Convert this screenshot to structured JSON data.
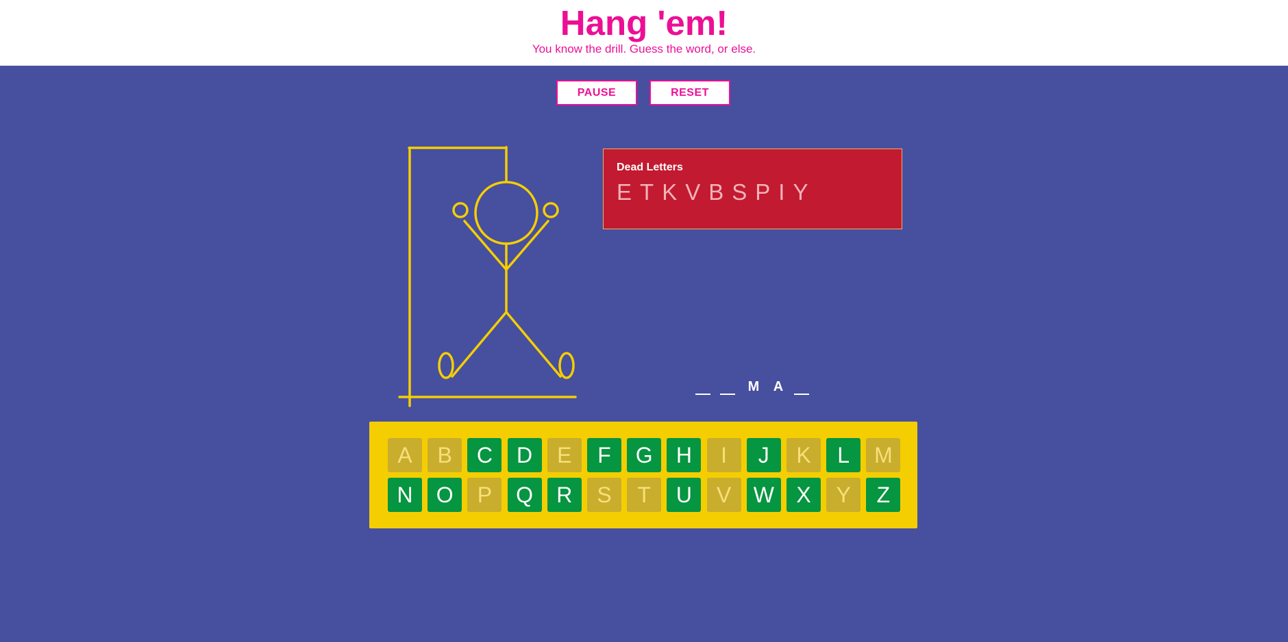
{
  "header": {
    "title": "Hang 'em!",
    "subtitle": "You know the drill. Guess the word, or else."
  },
  "controls": {
    "pause_label": "PAUSE",
    "reset_label": "RESET"
  },
  "dead_letters": {
    "title": "Dead Letters",
    "letters": [
      "E",
      "T",
      "K",
      "V",
      "B",
      "S",
      "P",
      "I",
      "Y"
    ]
  },
  "word": {
    "slots": [
      "",
      "",
      "M",
      "A",
      ""
    ]
  },
  "colors": {
    "accent": "#ec0f96",
    "background": "#474f9f",
    "gallows": "#f5ce02",
    "available_key": "#069540",
    "used_key": "#c9ad2d",
    "dead_box": "#c21a30"
  },
  "keyboard": {
    "rows": [
      [
        {
          "letter": "A",
          "state": "used"
        },
        {
          "letter": "B",
          "state": "used"
        },
        {
          "letter": "C",
          "state": "available"
        },
        {
          "letter": "D",
          "state": "available"
        },
        {
          "letter": "E",
          "state": "used"
        },
        {
          "letter": "F",
          "state": "available"
        },
        {
          "letter": "G",
          "state": "available"
        },
        {
          "letter": "H",
          "state": "available"
        },
        {
          "letter": "I",
          "state": "used"
        },
        {
          "letter": "J",
          "state": "available"
        },
        {
          "letter": "K",
          "state": "used"
        },
        {
          "letter": "L",
          "state": "available"
        },
        {
          "letter": "M",
          "state": "used"
        }
      ],
      [
        {
          "letter": "N",
          "state": "available"
        },
        {
          "letter": "O",
          "state": "available"
        },
        {
          "letter": "P",
          "state": "used"
        },
        {
          "letter": "Q",
          "state": "available"
        },
        {
          "letter": "R",
          "state": "available"
        },
        {
          "letter": "S",
          "state": "used"
        },
        {
          "letter": "T",
          "state": "used"
        },
        {
          "letter": "U",
          "state": "available"
        },
        {
          "letter": "V",
          "state": "used"
        },
        {
          "letter": "W",
          "state": "available"
        },
        {
          "letter": "X",
          "state": "available"
        },
        {
          "letter": "Y",
          "state": "used"
        },
        {
          "letter": "Z",
          "state": "available"
        }
      ]
    ]
  }
}
